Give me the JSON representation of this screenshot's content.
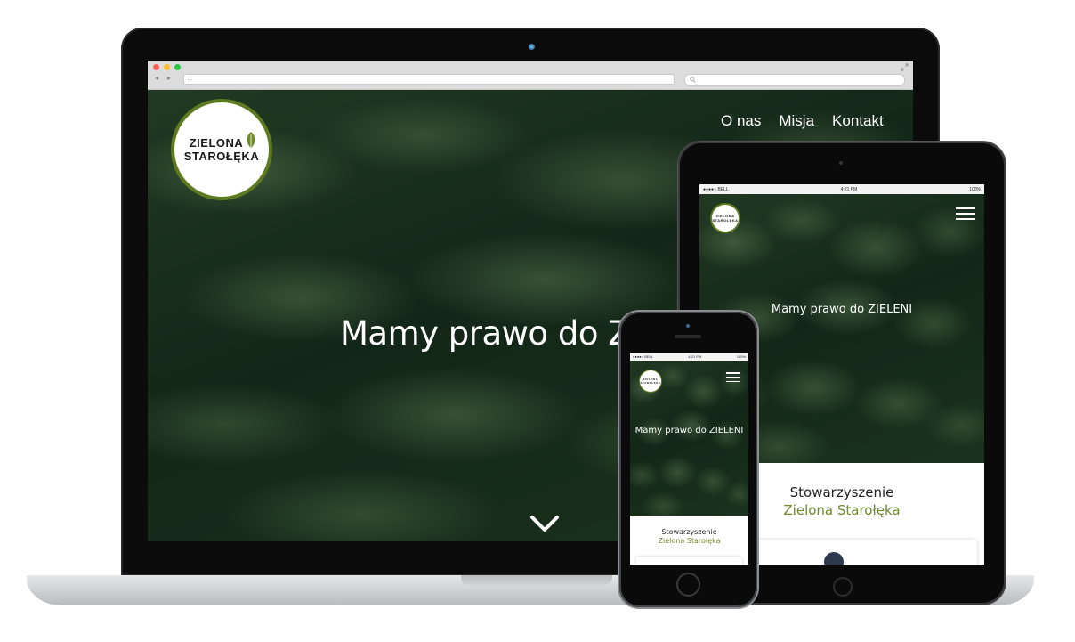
{
  "colors": {
    "brand_green": "#5d7a1f",
    "org_name_green": "#6e8a2a",
    "device_black": "#0a0a0a",
    "browser_chrome": "#dcdcdc"
  },
  "desktop": {
    "browser": {
      "traffic_lights": [
        "#ff5f57",
        "#febc2e",
        "#28c840"
      ],
      "nav_back_icon": "◂",
      "nav_forward_icon": "▸",
      "url_plus": "+",
      "search_icon": "magnifier-icon"
    },
    "logo": {
      "line1": "ZIELONA",
      "line2": "STAROŁĘKA"
    },
    "nav": [
      {
        "label": "O nas"
      },
      {
        "label": "Misja"
      },
      {
        "label": "Kontakt"
      }
    ],
    "hero_title": "Mamy prawo do Z",
    "scroll_icon": "chevron-down-icon"
  },
  "tablet": {
    "status": {
      "carrier": "●●●●○ BELL",
      "time": "4:21 PM",
      "battery": "100%"
    },
    "logo": {
      "line1": "ZIELONA",
      "line2": "STAROŁĘKA"
    },
    "hero_title": "Mamy prawo do ZIELENI",
    "org": {
      "line1": "Stowarzyszenie",
      "line2": "Zielona Starołęka"
    }
  },
  "phone": {
    "status": {
      "carrier": "●●●●○ BELL",
      "time": "4:21 PM",
      "battery": "100%"
    },
    "logo": {
      "line1": "ZIELONA",
      "line2": "STAROŁĘKA"
    },
    "hero_title": "Mamy prawo do ZIELENI",
    "org": {
      "line1": "Stowarzyszenie",
      "line2": "Zielona Starołęka"
    }
  }
}
